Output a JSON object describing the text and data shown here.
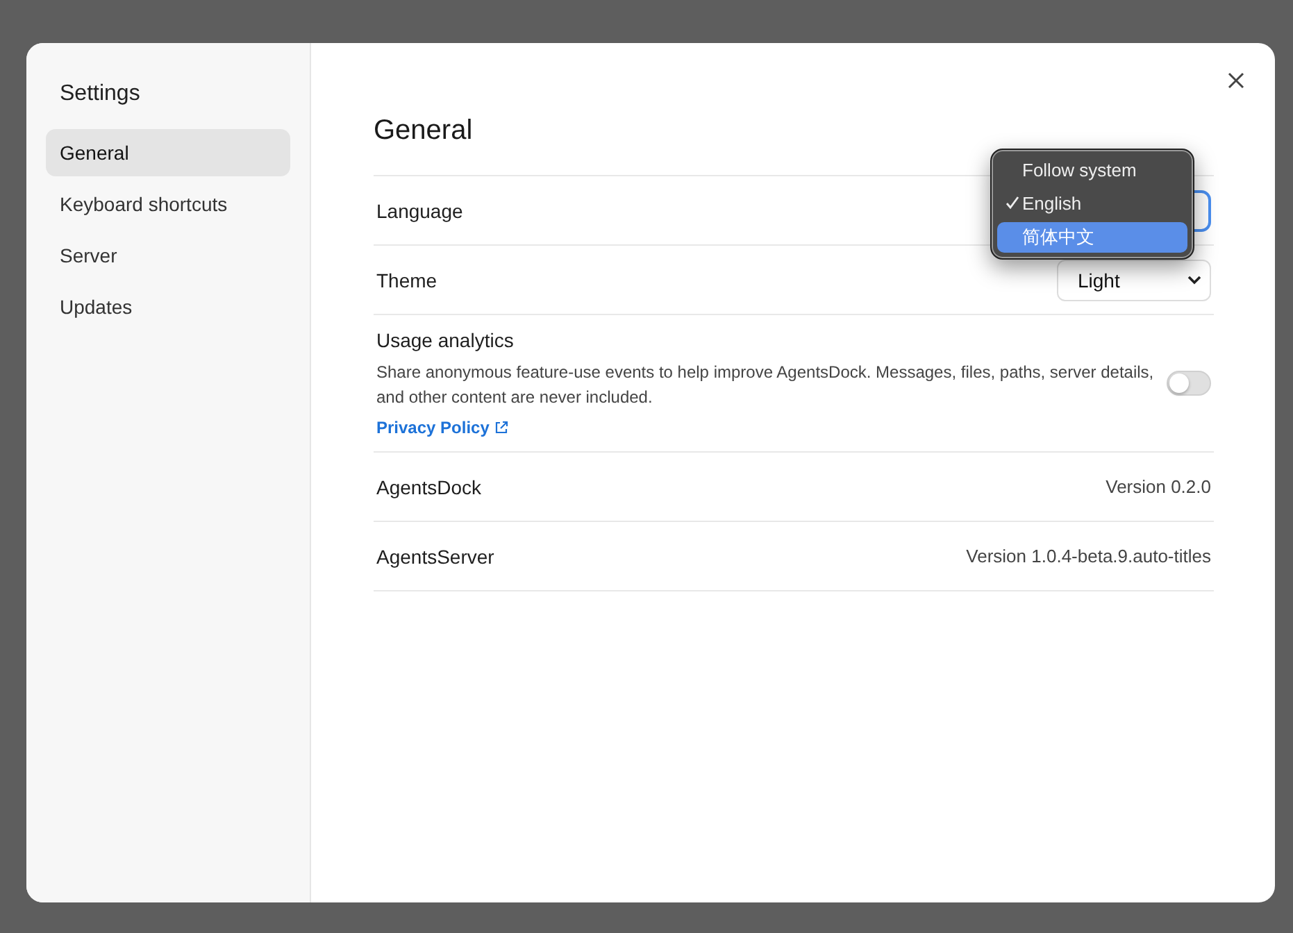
{
  "sidebar": {
    "title": "Settings",
    "items": [
      {
        "label": "General",
        "selected": true
      },
      {
        "label": "Keyboard shortcuts",
        "selected": false
      },
      {
        "label": "Server",
        "selected": false
      },
      {
        "label": "Updates",
        "selected": false
      }
    ]
  },
  "content": {
    "heading": "General",
    "rows": [
      {
        "kind": "select",
        "label": "Language",
        "focused": true,
        "menu": [
          {
            "label": "Follow system",
            "checked": false,
            "selected": false
          },
          {
            "label": "English",
            "checked": true,
            "selected": false
          },
          {
            "label": "简体中文",
            "checked": false,
            "selected": true
          }
        ]
      },
      {
        "kind": "select",
        "label": "Theme",
        "value": "Light",
        "focused": false
      },
      {
        "kind": "toggle",
        "label": "Usage analytics",
        "description": "Share anonymous feature-use events to help improve AgentsDock. Messages, files, paths, server details, and other content are never included.",
        "link": "Privacy Policy",
        "on": false
      },
      {
        "kind": "info",
        "label": "AgentsDock",
        "value": "Version 0.2.0"
      },
      {
        "kind": "info",
        "label": "AgentsServer",
        "value": "Version 1.0.4-beta.9.auto-titles"
      }
    ]
  }
}
